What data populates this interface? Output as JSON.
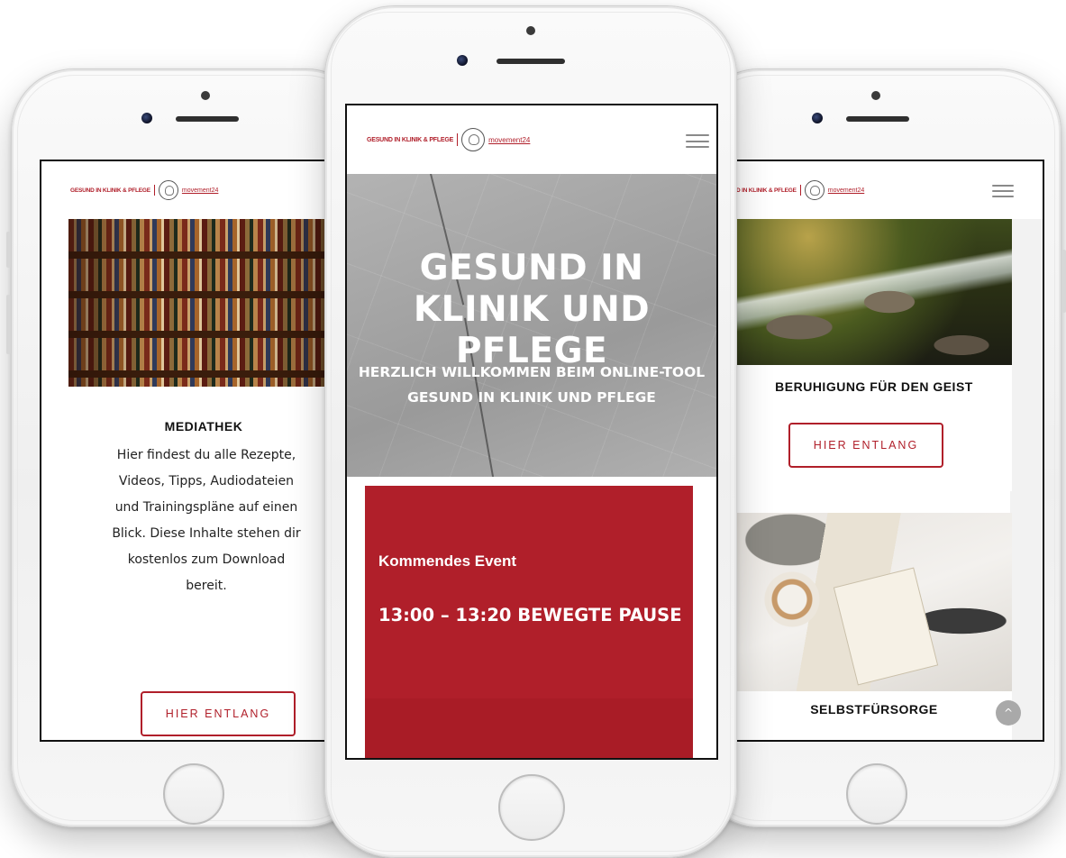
{
  "brand": {
    "logo_text": "GESUND IN KLINIK & PFLEGE",
    "logo_text_truncated": "D IN KLINIK & PFLEGE",
    "partner": "movement24",
    "accent_color": "#b01f2a"
  },
  "left_screen": {
    "card_title": "MEDIATHEK",
    "card_body": "Hier findest du alle Rezepte, Videos, Tipps, Audiodateien und Trainingspläne auf einen Blick. Diese Inhalte stehen dir kostenlos zum Download bereit.",
    "button_label": "HIER ENTLANG"
  },
  "center_screen": {
    "hero_title": "GESUND IN KLINIK UND PFLEGE",
    "hero_subtitle": "HERZLICH WILLKOMMEN BEIM ONLINE-TOOL GESUND IN KLINIK UND PFLEGE",
    "event_label": "Kommendes Event",
    "event_title": "13:00 – 13:20 BEWEGTE PAUSE"
  },
  "right_screen": {
    "card1_title": "BERUHIGUNG FÜR DEN GEIST",
    "card1_button_label": "HIER ENTLANG",
    "card2_title": "SELBSTFÜRSORGE",
    "scroll_top_icon": "^"
  }
}
